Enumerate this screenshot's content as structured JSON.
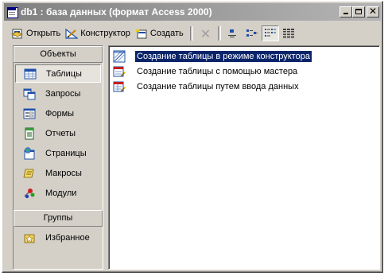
{
  "window": {
    "title": "db1 : база данных (формат Access 2000)",
    "icon": "database-icon"
  },
  "title_buttons": {
    "minimize": "minimize-icon",
    "maximize": "maximize-icon",
    "close": "close-icon",
    "close_glyph": "✕"
  },
  "toolbar": {
    "open_label": "Открыть",
    "design_label": "Конструктор",
    "create_label": "Создать",
    "delete_glyph": "✕",
    "icons": [
      "open-icon",
      "design-icon",
      "new-icon",
      "delete-icon",
      "large-icons-icon",
      "small-icons-icon",
      "list-view-icon",
      "details-view-icon"
    ]
  },
  "left_pane": {
    "objects_header": "Объекты",
    "items": [
      {
        "label": "Таблицы",
        "icon": "table-icon",
        "selected": true
      },
      {
        "label": "Запросы",
        "icon": "query-icon",
        "selected": false
      },
      {
        "label": "Формы",
        "icon": "form-icon",
        "selected": false
      },
      {
        "label": "Отчеты",
        "icon": "report-icon",
        "selected": false
      },
      {
        "label": "Страницы",
        "icon": "page-icon",
        "selected": false
      },
      {
        "label": "Макросы",
        "icon": "macro-icon",
        "selected": false
      },
      {
        "label": "Модули",
        "icon": "module-icon",
        "selected": false
      }
    ],
    "groups_header": "Группы",
    "groups": [
      {
        "label": "Избранное",
        "icon": "favorites-icon"
      }
    ]
  },
  "right_pane": {
    "items": [
      {
        "label": "Создание таблицы в режиме конструктора",
        "icon": "design-table-icon",
        "selected": true
      },
      {
        "label": "Создание таблицы с помощью мастера",
        "icon": "wizard-table-icon",
        "selected": false
      },
      {
        "label": "Создание таблицы путем ввода данных",
        "icon": "datasheet-table-icon",
        "selected": false
      }
    ]
  },
  "colors": {
    "face": "#d4d0c8",
    "title_inactive_left": "#808080",
    "title_inactive_right": "#b5b5b5",
    "selection": "#0a246a"
  }
}
